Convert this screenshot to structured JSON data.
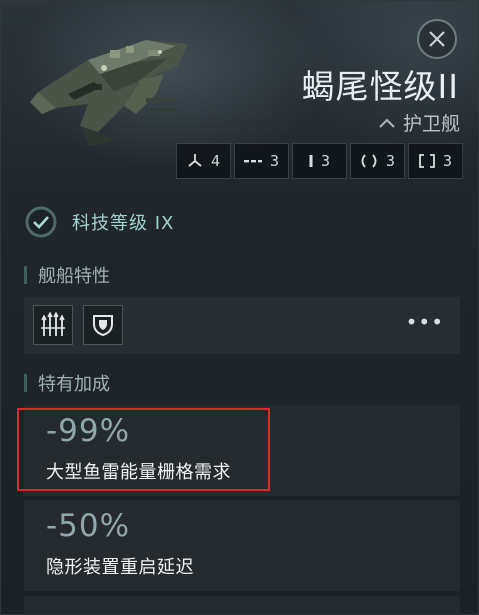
{
  "ship": {
    "name": "蝎尾怪级II",
    "class_label": "护卫舰",
    "class_icon": "chevron-up-icon"
  },
  "slots": [
    {
      "icon": "turret-hardpoint-icon",
      "count": "4"
    },
    {
      "icon": "launcher-hardpoint-icon",
      "count": "3"
    },
    {
      "icon": "high-slot-icon",
      "count": "3"
    },
    {
      "icon": "mid-slot-icon",
      "count": "3"
    },
    {
      "icon": "low-slot-icon",
      "count": "3"
    }
  ],
  "tech": {
    "label": "科技等级 IX",
    "icon": "check-circle-icon"
  },
  "traits_section": {
    "title": "舰船特性",
    "icons": [
      "missile-launchers-icon",
      "shield-icon"
    ],
    "more_label": "•••"
  },
  "bonus_section": {
    "title": "特有加成",
    "bonuses": [
      {
        "value": "-99%",
        "text": "大型鱼雷能量栅格需求"
      },
      {
        "value": "-50%",
        "text": "隐形装置重启延迟"
      }
    ]
  },
  "colors": {
    "accent_teal": "#9fd3cf",
    "highlight_red": "#e0262a",
    "bonus_value": "#8ea7ab"
  }
}
